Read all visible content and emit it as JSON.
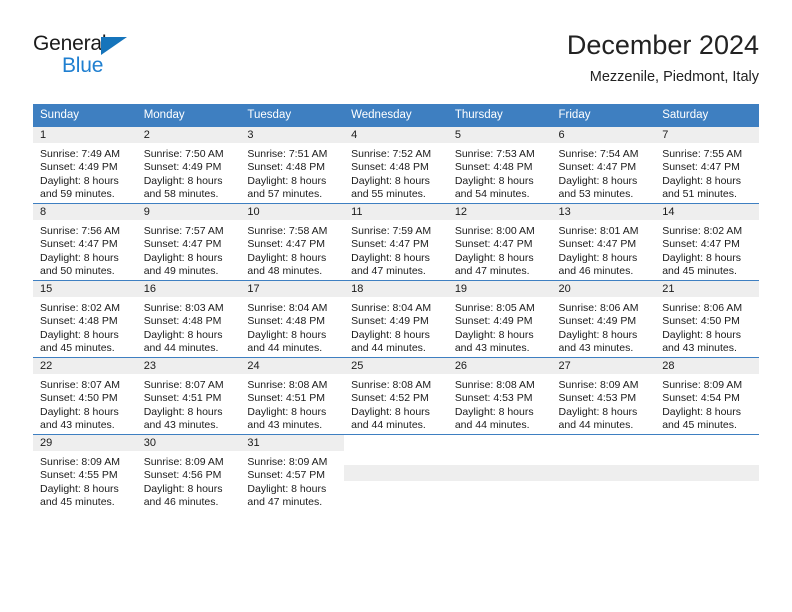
{
  "brand": {
    "name_part1": "General",
    "name_part2": "Blue",
    "accent_color": "#1f7fd0",
    "triangle_color": "#1574bb"
  },
  "header": {
    "title": "December 2024",
    "subtitle": "Mezzenile, Piedmont, Italy"
  },
  "calendar": {
    "header_bg": "#3e7fc1",
    "daynum_bg": "#eeeeee",
    "weekday_headers": [
      "Sunday",
      "Monday",
      "Tuesday",
      "Wednesday",
      "Thursday",
      "Friday",
      "Saturday"
    ],
    "weeks": [
      [
        {
          "day": "1",
          "sunrise": "Sunrise: 7:49 AM",
          "sunset": "Sunset: 4:49 PM",
          "daylight_line1": "Daylight: 8 hours",
          "daylight_line2": "and 59 minutes."
        },
        {
          "day": "2",
          "sunrise": "Sunrise: 7:50 AM",
          "sunset": "Sunset: 4:49 PM",
          "daylight_line1": "Daylight: 8 hours",
          "daylight_line2": "and 58 minutes."
        },
        {
          "day": "3",
          "sunrise": "Sunrise: 7:51 AM",
          "sunset": "Sunset: 4:48 PM",
          "daylight_line1": "Daylight: 8 hours",
          "daylight_line2": "and 57 minutes."
        },
        {
          "day": "4",
          "sunrise": "Sunrise: 7:52 AM",
          "sunset": "Sunset: 4:48 PM",
          "daylight_line1": "Daylight: 8 hours",
          "daylight_line2": "and 55 minutes."
        },
        {
          "day": "5",
          "sunrise": "Sunrise: 7:53 AM",
          "sunset": "Sunset: 4:48 PM",
          "daylight_line1": "Daylight: 8 hours",
          "daylight_line2": "and 54 minutes."
        },
        {
          "day": "6",
          "sunrise": "Sunrise: 7:54 AM",
          "sunset": "Sunset: 4:47 PM",
          "daylight_line1": "Daylight: 8 hours",
          "daylight_line2": "and 53 minutes."
        },
        {
          "day": "7",
          "sunrise": "Sunrise: 7:55 AM",
          "sunset": "Sunset: 4:47 PM",
          "daylight_line1": "Daylight: 8 hours",
          "daylight_line2": "and 51 minutes."
        }
      ],
      [
        {
          "day": "8",
          "sunrise": "Sunrise: 7:56 AM",
          "sunset": "Sunset: 4:47 PM",
          "daylight_line1": "Daylight: 8 hours",
          "daylight_line2": "and 50 minutes."
        },
        {
          "day": "9",
          "sunrise": "Sunrise: 7:57 AM",
          "sunset": "Sunset: 4:47 PM",
          "daylight_line1": "Daylight: 8 hours",
          "daylight_line2": "and 49 minutes."
        },
        {
          "day": "10",
          "sunrise": "Sunrise: 7:58 AM",
          "sunset": "Sunset: 4:47 PM",
          "daylight_line1": "Daylight: 8 hours",
          "daylight_line2": "and 48 minutes."
        },
        {
          "day": "11",
          "sunrise": "Sunrise: 7:59 AM",
          "sunset": "Sunset: 4:47 PM",
          "daylight_line1": "Daylight: 8 hours",
          "daylight_line2": "and 47 minutes."
        },
        {
          "day": "12",
          "sunrise": "Sunrise: 8:00 AM",
          "sunset": "Sunset: 4:47 PM",
          "daylight_line1": "Daylight: 8 hours",
          "daylight_line2": "and 47 minutes."
        },
        {
          "day": "13",
          "sunrise": "Sunrise: 8:01 AM",
          "sunset": "Sunset: 4:47 PM",
          "daylight_line1": "Daylight: 8 hours",
          "daylight_line2": "and 46 minutes."
        },
        {
          "day": "14",
          "sunrise": "Sunrise: 8:02 AM",
          "sunset": "Sunset: 4:47 PM",
          "daylight_line1": "Daylight: 8 hours",
          "daylight_line2": "and 45 minutes."
        }
      ],
      [
        {
          "day": "15",
          "sunrise": "Sunrise: 8:02 AM",
          "sunset": "Sunset: 4:48 PM",
          "daylight_line1": "Daylight: 8 hours",
          "daylight_line2": "and 45 minutes."
        },
        {
          "day": "16",
          "sunrise": "Sunrise: 8:03 AM",
          "sunset": "Sunset: 4:48 PM",
          "daylight_line1": "Daylight: 8 hours",
          "daylight_line2": "and 44 minutes."
        },
        {
          "day": "17",
          "sunrise": "Sunrise: 8:04 AM",
          "sunset": "Sunset: 4:48 PM",
          "daylight_line1": "Daylight: 8 hours",
          "daylight_line2": "and 44 minutes."
        },
        {
          "day": "18",
          "sunrise": "Sunrise: 8:04 AM",
          "sunset": "Sunset: 4:49 PM",
          "daylight_line1": "Daylight: 8 hours",
          "daylight_line2": "and 44 minutes."
        },
        {
          "day": "19",
          "sunrise": "Sunrise: 8:05 AM",
          "sunset": "Sunset: 4:49 PM",
          "daylight_line1": "Daylight: 8 hours",
          "daylight_line2": "and 43 minutes."
        },
        {
          "day": "20",
          "sunrise": "Sunrise: 8:06 AM",
          "sunset": "Sunset: 4:49 PM",
          "daylight_line1": "Daylight: 8 hours",
          "daylight_line2": "and 43 minutes."
        },
        {
          "day": "21",
          "sunrise": "Sunrise: 8:06 AM",
          "sunset": "Sunset: 4:50 PM",
          "daylight_line1": "Daylight: 8 hours",
          "daylight_line2": "and 43 minutes."
        }
      ],
      [
        {
          "day": "22",
          "sunrise": "Sunrise: 8:07 AM",
          "sunset": "Sunset: 4:50 PM",
          "daylight_line1": "Daylight: 8 hours",
          "daylight_line2": "and 43 minutes."
        },
        {
          "day": "23",
          "sunrise": "Sunrise: 8:07 AM",
          "sunset": "Sunset: 4:51 PM",
          "daylight_line1": "Daylight: 8 hours",
          "daylight_line2": "and 43 minutes."
        },
        {
          "day": "24",
          "sunrise": "Sunrise: 8:08 AM",
          "sunset": "Sunset: 4:51 PM",
          "daylight_line1": "Daylight: 8 hours",
          "daylight_line2": "and 43 minutes."
        },
        {
          "day": "25",
          "sunrise": "Sunrise: 8:08 AM",
          "sunset": "Sunset: 4:52 PM",
          "daylight_line1": "Daylight: 8 hours",
          "daylight_line2": "and 44 minutes."
        },
        {
          "day": "26",
          "sunrise": "Sunrise: 8:08 AM",
          "sunset": "Sunset: 4:53 PM",
          "daylight_line1": "Daylight: 8 hours",
          "daylight_line2": "and 44 minutes."
        },
        {
          "day": "27",
          "sunrise": "Sunrise: 8:09 AM",
          "sunset": "Sunset: 4:53 PM",
          "daylight_line1": "Daylight: 8 hours",
          "daylight_line2": "and 44 minutes."
        },
        {
          "day": "28",
          "sunrise": "Sunrise: 8:09 AM",
          "sunset": "Sunset: 4:54 PM",
          "daylight_line1": "Daylight: 8 hours",
          "daylight_line2": "and 45 minutes."
        }
      ],
      [
        {
          "day": "29",
          "sunrise": "Sunrise: 8:09 AM",
          "sunset": "Sunset: 4:55 PM",
          "daylight_line1": "Daylight: 8 hours",
          "daylight_line2": "and 45 minutes."
        },
        {
          "day": "30",
          "sunrise": "Sunrise: 8:09 AM",
          "sunset": "Sunset: 4:56 PM",
          "daylight_line1": "Daylight: 8 hours",
          "daylight_line2": "and 46 minutes."
        },
        {
          "day": "31",
          "sunrise": "Sunrise: 8:09 AM",
          "sunset": "Sunset: 4:57 PM",
          "daylight_line1": "Daylight: 8 hours",
          "daylight_line2": "and 47 minutes."
        },
        null,
        null,
        null,
        null
      ]
    ]
  }
}
